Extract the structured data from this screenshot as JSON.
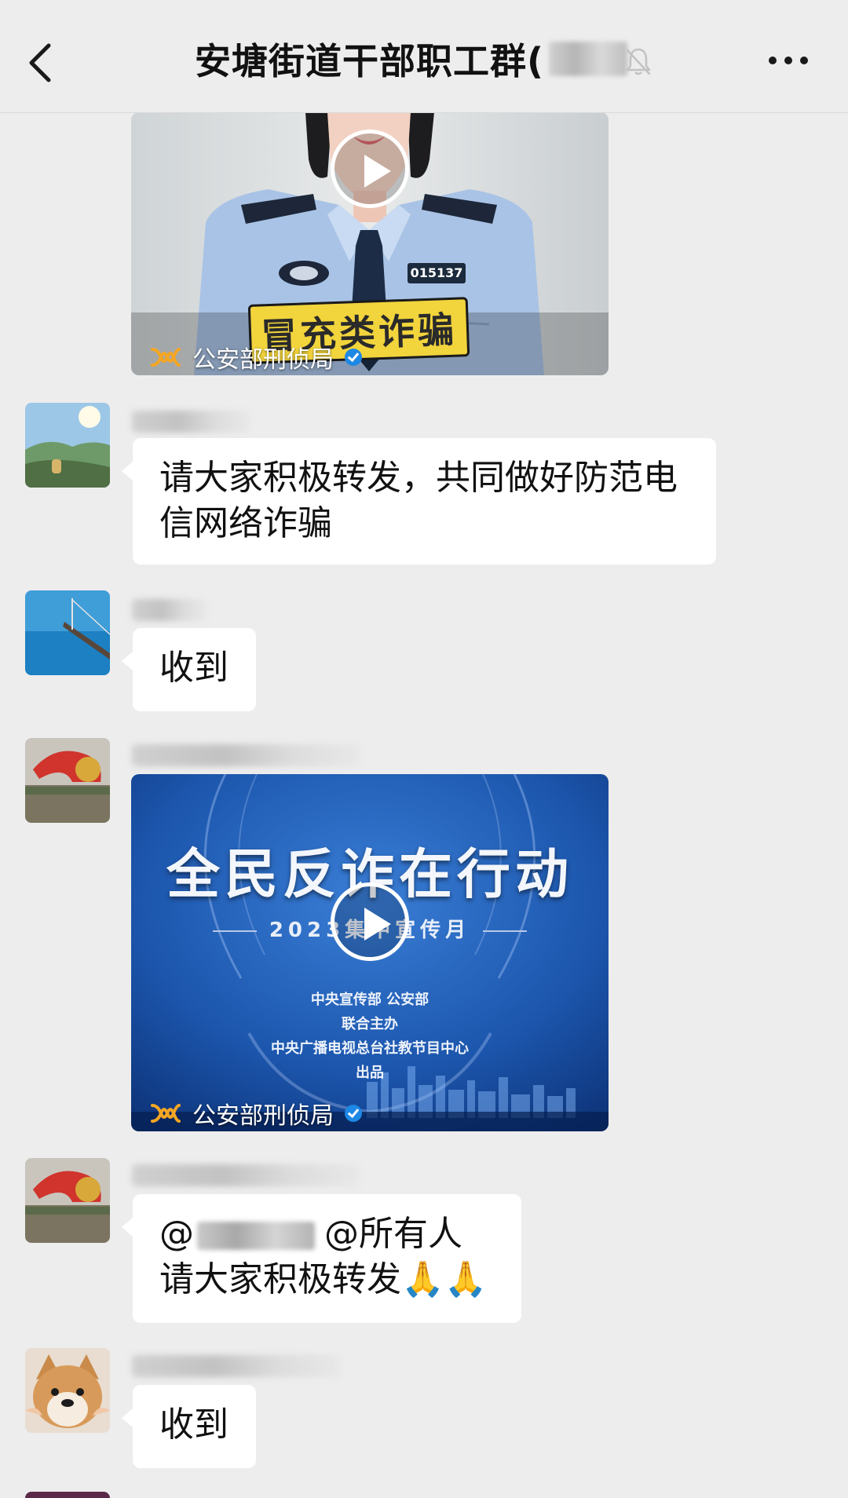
{
  "header": {
    "title": "安塘街道干部职工群(",
    "back_icon": "chevron-left-icon",
    "mute_icon": "bell-off-icon",
    "more_icon": "more-dots-icon"
  },
  "messages": [
    {
      "type": "video",
      "channel": "公安部刑侦局",
      "caption": "冒充类诈骗",
      "badge": "015137"
    },
    {
      "type": "text",
      "lines": [
        "请大家积极转发，共同做好防范电",
        "信网络诈骗"
      ]
    },
    {
      "type": "text",
      "lines": [
        "收到"
      ]
    },
    {
      "type": "video",
      "channel": "公安部刑侦局",
      "title": "全民反诈在行动",
      "subtitle": "2023集中宣传月",
      "credits": [
        "中央宣传部  公安部",
        "联合主办",
        "中央广播电视总台社教节目中心",
        "出品"
      ]
    },
    {
      "type": "text",
      "lines": [
        "@所有人",
        "请大家积极转发🙏🙏"
      ]
    },
    {
      "type": "text",
      "lines": [
        "收到"
      ]
    }
  ],
  "colors": {
    "background": "#ededed",
    "bubble": "#ffffff",
    "verified": "#1e88e5",
    "channel_logo": "#f5a623"
  }
}
